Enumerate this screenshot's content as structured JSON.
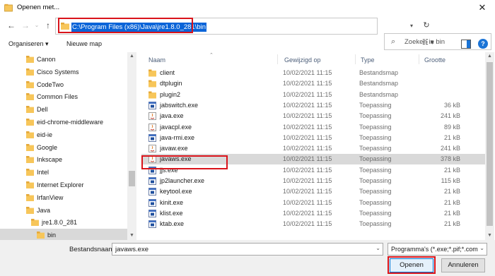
{
  "window": {
    "title": "Openen met...",
    "close_glyph": "✕"
  },
  "address": {
    "path": "C:\\Program Files (x86)\\Java\\jre1.8.0_281\\bin",
    "search_placeholder": "Zoeken in bin"
  },
  "toolbar": {
    "organize": "Organiseren",
    "organize_caret": "▾",
    "new_folder": "Nieuwe map",
    "help": "?"
  },
  "nav_tree": [
    {
      "label": "Canon",
      "level": 1,
      "selected": false
    },
    {
      "label": "Cisco Systems",
      "level": 1,
      "selected": false
    },
    {
      "label": "CodeTwo",
      "level": 1,
      "selected": false
    },
    {
      "label": "Common Files",
      "level": 1,
      "selected": false
    },
    {
      "label": "Dell",
      "level": 1,
      "selected": false
    },
    {
      "label": "eid-chrome-middleware",
      "level": 1,
      "selected": false
    },
    {
      "label": "eid-ie",
      "level": 1,
      "selected": false
    },
    {
      "label": "Google",
      "level": 1,
      "selected": false
    },
    {
      "label": "Inkscape",
      "level": 1,
      "selected": false
    },
    {
      "label": "Intel",
      "level": 1,
      "selected": false
    },
    {
      "label": "Internet Explorer",
      "level": 1,
      "selected": false
    },
    {
      "label": "IrfanView",
      "level": 1,
      "selected": false
    },
    {
      "label": "Java",
      "level": 1,
      "selected": false
    },
    {
      "label": "jre1.8.0_281",
      "level": 2,
      "selected": false
    },
    {
      "label": "bin",
      "level": 3,
      "selected": true
    }
  ],
  "columns": {
    "name": "Naam",
    "modified": "Gewijzigd op",
    "type": "Type",
    "size": "Grootte"
  },
  "files": [
    {
      "name": "client",
      "modified": "10/02/2021 11:15",
      "type": "Bestandsmap",
      "size": "",
      "icon": "folder-icon",
      "selected": false
    },
    {
      "name": "dtplugin",
      "modified": "10/02/2021 11:15",
      "type": "Bestandsmap",
      "size": "",
      "icon": "folder-icon",
      "selected": false
    },
    {
      "name": "plugin2",
      "modified": "10/02/2021 11:15",
      "type": "Bestandsmap",
      "size": "",
      "icon": "folder-icon",
      "selected": false
    },
    {
      "name": "jabswitch.exe",
      "modified": "10/02/2021 11:15",
      "type": "Toepassing",
      "size": "36 kB",
      "icon": "exe-icon",
      "selected": false
    },
    {
      "name": "java.exe",
      "modified": "10/02/2021 11:15",
      "type": "Toepassing",
      "size": "241 kB",
      "icon": "java-icon",
      "selected": false
    },
    {
      "name": "javacpl.exe",
      "modified": "10/02/2021 11:15",
      "type": "Toepassing",
      "size": "89 kB",
      "icon": "java-icon",
      "selected": false
    },
    {
      "name": "java-rmi.exe",
      "modified": "10/02/2021 11:15",
      "type": "Toepassing",
      "size": "21 kB",
      "icon": "exe-icon",
      "selected": false
    },
    {
      "name": "javaw.exe",
      "modified": "10/02/2021 11:15",
      "type": "Toepassing",
      "size": "241 kB",
      "icon": "java-icon",
      "selected": false
    },
    {
      "name": "javaws.exe",
      "modified": "10/02/2021 11:15",
      "type": "Toepassing",
      "size": "378 kB",
      "icon": "java-icon",
      "selected": true
    },
    {
      "name": "jjs.exe",
      "modified": "10/02/2021 11:15",
      "type": "Toepassing",
      "size": "21 kB",
      "icon": "exe-icon",
      "selected": false
    },
    {
      "name": "jp2launcher.exe",
      "modified": "10/02/2021 11:15",
      "type": "Toepassing",
      "size": "115 kB",
      "icon": "exe-icon",
      "selected": false
    },
    {
      "name": "keytool.exe",
      "modified": "10/02/2021 11:15",
      "type": "Toepassing",
      "size": "21 kB",
      "icon": "exe-icon",
      "selected": false
    },
    {
      "name": "kinit.exe",
      "modified": "10/02/2021 11:15",
      "type": "Toepassing",
      "size": "21 kB",
      "icon": "exe-icon",
      "selected": false
    },
    {
      "name": "klist.exe",
      "modified": "10/02/2021 11:15",
      "type": "Toepassing",
      "size": "21 kB",
      "icon": "exe-icon",
      "selected": false
    },
    {
      "name": "ktab.exe",
      "modified": "10/02/2021 11:15",
      "type": "Toepassing",
      "size": "21 kB",
      "icon": "exe-icon",
      "selected": false
    }
  ],
  "bottom": {
    "filename_label": "Bestandsnaam:",
    "filename_value": "javaws.exe",
    "filter_value": "Programma's (*.exe;*.pif;*.com",
    "open_label": "Openen",
    "cancel_label": "Annuleren"
  },
  "colors": {
    "highlight_box": "#d9141b",
    "path_selection": "#0a64d8",
    "selected_row": "#d9d9d9",
    "folder": "#f7c65a"
  }
}
